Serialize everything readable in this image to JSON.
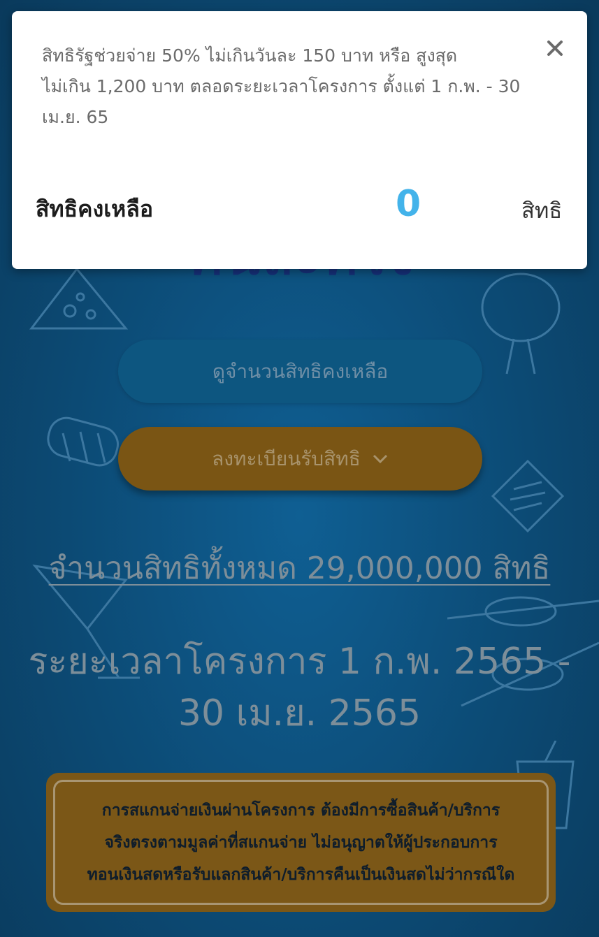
{
  "modal": {
    "description_lines": [
      "สิทธิรัฐช่วยจ่าย 50% ไม่เกินวันละ 150 บาท หรือ สูงสุด",
      "ไม่เกิน 1,200 บาท ตลอดระยะเวลาโครงการ ตั้งแต่ 1 ก.พ. - 30",
      "เม.ย. 65"
    ],
    "close_icon": "close-icon",
    "remaining_label": "สิทธิคงเหลือ",
    "remaining_value": "0",
    "remaining_unit": "สิทธิ"
  },
  "page": {
    "check_button_label": "ดูจำนวนสิทธิคงเหลือ",
    "register_button_label": "ลงทะเบียนรับสิทธิ",
    "register_icon": "chevron-down-icon",
    "total_rights_text": "จำนวนสิทธิทั้งหมด 29,000,000 สิทธิ",
    "period_lines": [
      "ระยะเวลาโครงการ 1 ก.พ. 2565 -",
      "30 เม.ย. 2565"
    ],
    "notice_lines": [
      "การสแกนจ่ายเงินผ่านโครงการ ต้องมีการซื้อสินค้า/บริการ",
      "จริงตรงตามมูลค่าที่สแกนจ่าย ไม่อนุญาตให้ผู้ประกอบการ",
      "ทอนเงินสดหรือรับแลกสินค้า/บริการคืนเป็นเงินสดไม่ว่ากรณีใด"
    ]
  },
  "colors": {
    "accent_blue": "#43b3ea",
    "background_blue": "#0c4a74",
    "register_gold": "#7a5514"
  }
}
